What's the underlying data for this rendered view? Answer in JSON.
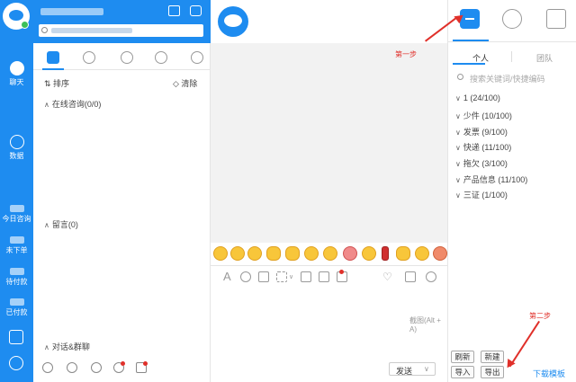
{
  "rail": {
    "items": [
      {
        "label": "聊天"
      },
      {
        "label": "数据"
      },
      {
        "label": "今日咨询"
      },
      {
        "label": "未下单"
      },
      {
        "label": "待付款"
      },
      {
        "label": "已付款"
      }
    ]
  },
  "list": {
    "sort_label": "排序",
    "clear_label": "清除",
    "group_online": "在线咨询(0/0)",
    "group_message": "留言(0)",
    "group_chat": "对话&群聊"
  },
  "chat": {
    "screenshot_hint": "截图(Alt + A)",
    "send_label": "发送"
  },
  "right": {
    "segment_personal": "个人",
    "segment_team": "团队",
    "search_placeholder": "搜索关键词/快捷编码",
    "tree": [
      "1 (24/100)",
      "少件 (10/100)",
      "发票 (9/100)",
      "快递 (11/100)",
      "拖欠 (3/100)",
      "产品信息 (11/100)",
      "三证 (1/100)"
    ],
    "buttons": {
      "refresh": "刷新",
      "create": "新建",
      "import": "导入",
      "export": "导出"
    },
    "download_template": "下载模板"
  },
  "annotations": {
    "step1": "第一步",
    "step2": "第二步"
  },
  "colors": {
    "brand": "#1e8cf0",
    "annotation": "#e0302a"
  }
}
